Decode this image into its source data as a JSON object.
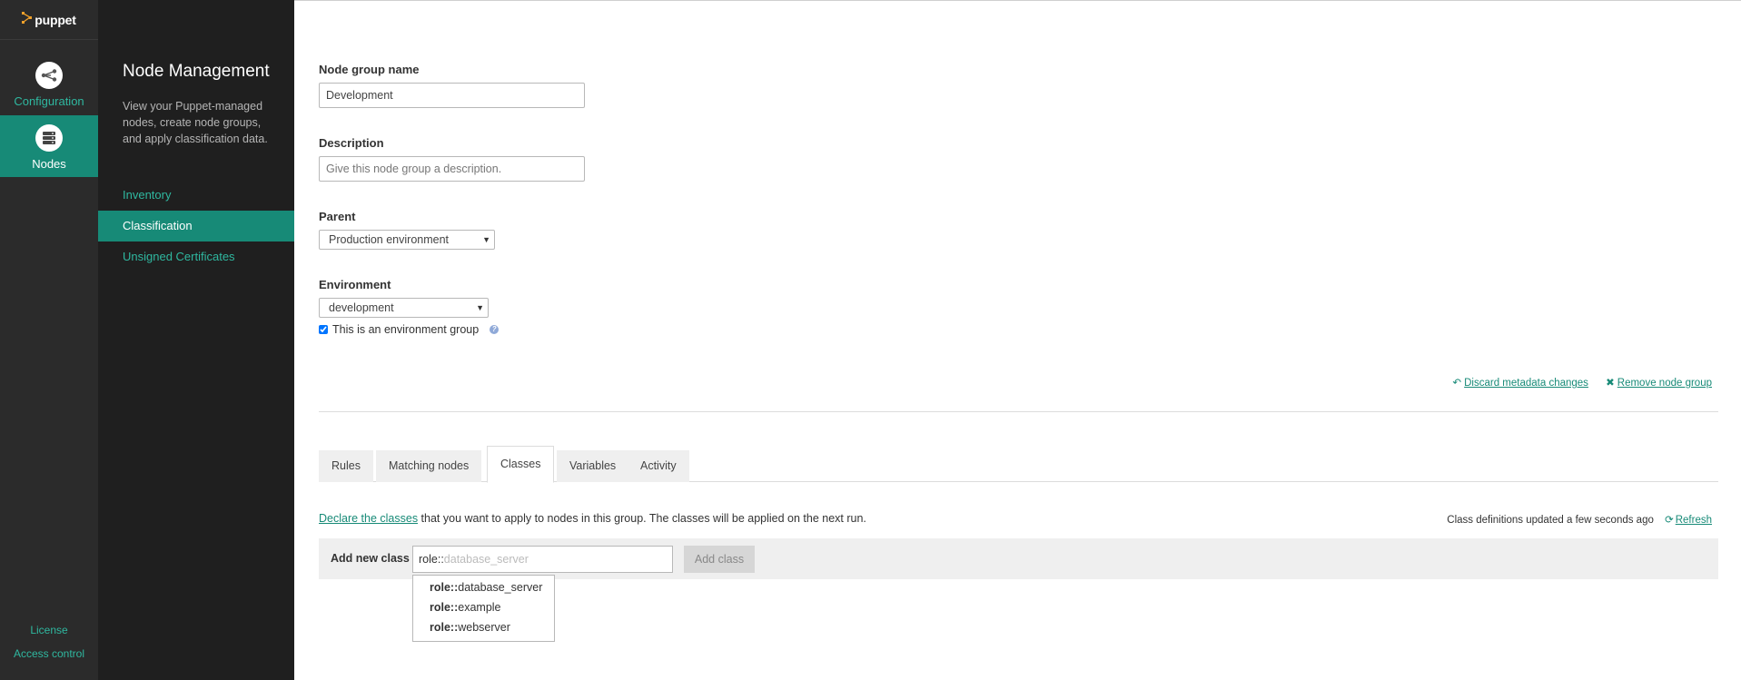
{
  "brand": {
    "logo_text": "puppet"
  },
  "rail": {
    "items": [
      {
        "label": "Configuration",
        "icon": "configuration-icon"
      },
      {
        "label": "Nodes",
        "icon": "nodes-icon"
      }
    ],
    "bottom_links": [
      "License",
      "Access control"
    ]
  },
  "sidebar": {
    "title": "Node Management",
    "description": "View your Puppet-managed nodes, create node groups, and apply classification data.",
    "items": [
      {
        "label": "Inventory"
      },
      {
        "label": "Classification"
      },
      {
        "label": "Unsigned Certificates"
      }
    ]
  },
  "form": {
    "name_label": "Node group name",
    "name_value": "Development",
    "description_label": "Description",
    "description_placeholder": "Give this node group a description.",
    "parent_label": "Parent",
    "parent_value": "Production environment",
    "environment_label": "Environment",
    "environment_value": "development",
    "env_group_label": "This is an environment group",
    "env_group_checked": true
  },
  "actions": {
    "discard": "Discard metadata changes",
    "remove": "Remove node group"
  },
  "tabs": [
    {
      "label": "Rules"
    },
    {
      "label": "Matching nodes"
    },
    {
      "label": "Classes"
    },
    {
      "label": "Variables"
    },
    {
      "label": "Activity"
    }
  ],
  "classes": {
    "declare_link": "Declare the classes",
    "declare_text": " that you want to apply to nodes in this group. The classes will be applied on the next run.",
    "updated_text": "Class definitions updated a few seconds ago",
    "refresh": "Refresh",
    "add_label": "Add new class",
    "input_typed": "role::",
    "input_ghost": "database_server",
    "add_button": "Add class",
    "suggestions": [
      {
        "prefix": "role::",
        "rest": "database_server"
      },
      {
        "prefix": "role::",
        "rest": "example"
      },
      {
        "prefix": "role::",
        "rest": "webserver"
      }
    ]
  },
  "colors": {
    "accent": "#178a77",
    "accent_text": "#2fb8a0",
    "rail_bg": "#2b2b2b",
    "sidebar_bg": "#1f1f1f"
  }
}
